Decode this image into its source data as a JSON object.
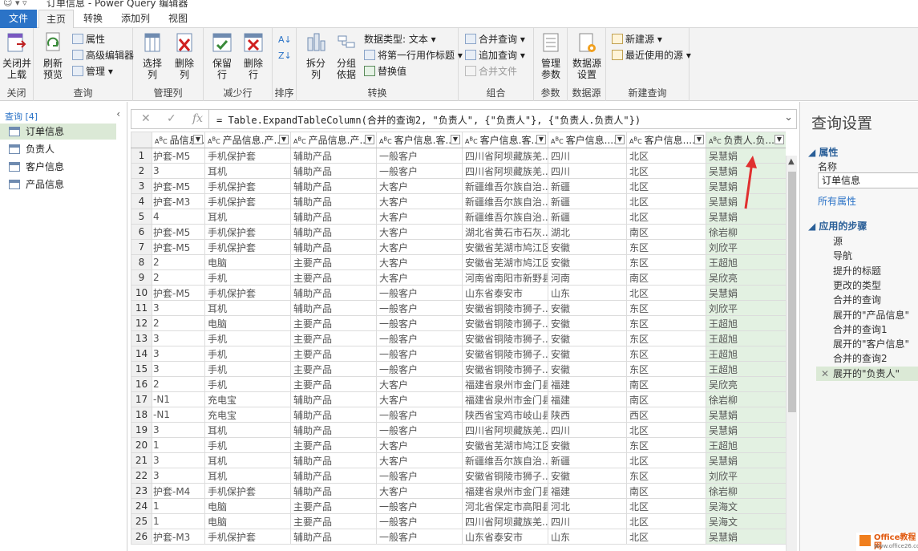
{
  "title": "订单信息 - Power Query 编辑器",
  "tabs": [
    {
      "label": "文件"
    },
    {
      "label": "主页"
    },
    {
      "label": "转换"
    },
    {
      "label": "添加列"
    },
    {
      "label": "视图"
    }
  ],
  "ribbon": {
    "close": {
      "btn": "关闭并\n上载",
      "group": "关闭"
    },
    "query": {
      "refresh": "刷新\n预览",
      "properties": "属性",
      "advanced_editor": "高级编辑器",
      "manage": "管理",
      "group": "查询"
    },
    "manage_cols": {
      "choose": "选择\n列",
      "remove": "删除\n列",
      "group": "管理列"
    },
    "reduce_rows": {
      "keep": "保留\n行",
      "remove": "删除\n行",
      "group": "减少行"
    },
    "sort": {
      "group": "排序"
    },
    "transform": {
      "split": "拆分\n列",
      "groupby": "分组\n依据",
      "datatype": "数据类型: 文本",
      "first_row": "将第一行用作标题",
      "replace": "替换值",
      "group": "转换"
    },
    "combine": {
      "merge": "合并查询",
      "append": "追加查询",
      "merge_files": "合并文件",
      "group": "组合"
    },
    "params": {
      "manage": "管理\n参数",
      "group": "参数"
    },
    "datasource": {
      "settings": "数据源\n设置",
      "group": "数据源"
    },
    "newquery": {
      "new_source": "新建源",
      "recent": "最近使用的源",
      "group": "新建查询"
    }
  },
  "nav": {
    "header": "查询 [4]",
    "items": [
      "订单信息",
      "负责人",
      "客户信息",
      "产品信息"
    ]
  },
  "formula": "= Table.ExpandTableColumn(合并的查询2, \"负责人\", {\"负责人\"}, {\"负责人.负责人\"})",
  "grid": {
    "columns": [
      "品信息....",
      "产品信息.产...",
      "产品信息.产...",
      "客户信息.客...",
      "客户信息.客...",
      "客户信息....",
      "客户信息....",
      "负责人.负..."
    ],
    "rows": [
      [
        "护套-M5",
        "手机保护套",
        "辅助产品",
        "一般客户",
        "四川省阿坝藏族羌...",
        "四川",
        "北区",
        "吴慧娟"
      ],
      [
        "3",
        "耳机",
        "辅助产品",
        "一般客户",
        "四川省阿坝藏族羌...",
        "四川",
        "北区",
        "吴慧娟"
      ],
      [
        "护套-M5",
        "手机保护套",
        "辅助产品",
        "大客户",
        "新疆维吾尔族自治...",
        "新疆",
        "北区",
        "吴慧娟"
      ],
      [
        "护套-M3",
        "手机保护套",
        "辅助产品",
        "大客户",
        "新疆维吾尔族自治...",
        "新疆",
        "北区",
        "吴慧娟"
      ],
      [
        "4",
        "耳机",
        "辅助产品",
        "大客户",
        "新疆维吾尔族自治...",
        "新疆",
        "北区",
        "吴慧娟"
      ],
      [
        "护套-M5",
        "手机保护套",
        "辅助产品",
        "大客户",
        "湖北省黄石市石灰...",
        "湖北",
        "南区",
        "徐岩柳"
      ],
      [
        "护套-M5",
        "手机保护套",
        "辅助产品",
        "大客户",
        "安徽省芜湖市鸠江区",
        "安徽",
        "东区",
        "刘欣平"
      ],
      [
        "2",
        "电脑",
        "主要产品",
        "大客户",
        "安徽省芜湖市鸠江区",
        "安徽",
        "东区",
        "王超旭"
      ],
      [
        "2",
        "手机",
        "主要产品",
        "大客户",
        "河南省南阳市新野县",
        "河南",
        "南区",
        "吴欣亮"
      ],
      [
        "护套-M5",
        "手机保护套",
        "辅助产品",
        "一般客户",
        "山东省泰安市",
        "山东",
        "北区",
        "吴慧娟"
      ],
      [
        "3",
        "耳机",
        "辅助产品",
        "一般客户",
        "安徽省铜陵市狮子...",
        "安徽",
        "东区",
        "刘欣平"
      ],
      [
        "2",
        "电脑",
        "主要产品",
        "一般客户",
        "安徽省铜陵市狮子...",
        "安徽",
        "东区",
        "王超旭"
      ],
      [
        "3",
        "手机",
        "主要产品",
        "一般客户",
        "安徽省铜陵市狮子...",
        "安徽",
        "东区",
        "王超旭"
      ],
      [
        "3",
        "手机",
        "主要产品",
        "一般客户",
        "安徽省铜陵市狮子...",
        "安徽",
        "东区",
        "王超旭"
      ],
      [
        "3",
        "手机",
        "主要产品",
        "一般客户",
        "安徽省铜陵市狮子...",
        "安徽",
        "东区",
        "王超旭"
      ],
      [
        "2",
        "手机",
        "主要产品",
        "大客户",
        "福建省泉州市金门县",
        "福建",
        "南区",
        "吴欣亮"
      ],
      [
        "-N1",
        "充电宝",
        "辅助产品",
        "大客户",
        "福建省泉州市金门县",
        "福建",
        "南区",
        "徐岩柳"
      ],
      [
        "-N1",
        "充电宝",
        "辅助产品",
        "一般客户",
        "陕西省宝鸡市岐山县",
        "陕西",
        "西区",
        "吴慧娟"
      ],
      [
        "3",
        "耳机",
        "辅助产品",
        "一般客户",
        "四川省阿坝藏族羌...",
        "四川",
        "北区",
        "吴慧娟"
      ],
      [
        "1",
        "手机",
        "主要产品",
        "大客户",
        "安徽省芜湖市鸠江区",
        "安徽",
        "东区",
        "王超旭"
      ],
      [
        "3",
        "耳机",
        "辅助产品",
        "大客户",
        "新疆维吾尔族自治...",
        "新疆",
        "北区",
        "吴慧娟"
      ],
      [
        "3",
        "耳机",
        "辅助产品",
        "一般客户",
        "安徽省铜陵市狮子...",
        "安徽",
        "东区",
        "刘欣平"
      ],
      [
        "护套-M4",
        "手机保护套",
        "辅助产品",
        "大客户",
        "福建省泉州市金门县",
        "福建",
        "南区",
        "徐岩柳"
      ],
      [
        "1",
        "电脑",
        "主要产品",
        "一般客户",
        "河北省保定市高阳县",
        "河北",
        "北区",
        "吴海文"
      ],
      [
        "1",
        "电脑",
        "主要产品",
        "一般客户",
        "四川省阿坝藏族羌...",
        "四川",
        "北区",
        "吴海文"
      ],
      [
        "护套-M3",
        "手机保护套",
        "辅助产品",
        "一般客户",
        "山东省泰安市",
        "山东",
        "北区",
        "吴慧娟"
      ]
    ]
  },
  "settings": {
    "title": "查询设置",
    "props_header": "属性",
    "name_label": "名称",
    "name_value": "订单信息",
    "all_props": "所有属性",
    "steps_header": "应用的步骤",
    "steps": [
      "源",
      "导航",
      "提升的标题",
      "更改的类型",
      "合并的查询",
      "展开的\"产品信息\"",
      "合并的查询1",
      "展开的\"客户信息\"",
      "合并的查询2",
      "展开的\"负责人\""
    ]
  },
  "watermark": {
    "line1": "Office教程网",
    "line2": "www.office26.com"
  },
  "colors": {
    "accent": "#2b73c7",
    "selection": "#dbe9d6",
    "arrow": "#e03030"
  }
}
